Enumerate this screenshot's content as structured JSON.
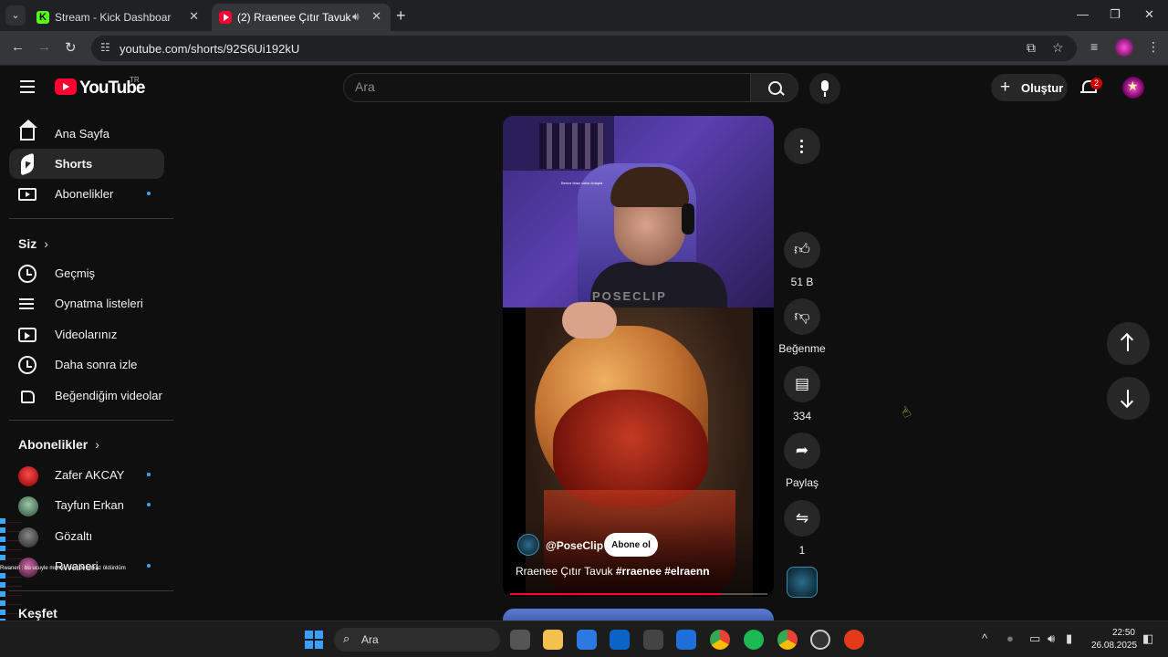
{
  "browser": {
    "tabs": [
      {
        "title": "Stream - Kick Dashboard",
        "active": false
      },
      {
        "title": "(2) Rraenee Çıtır Tavuk #rraenee",
        "active": true
      }
    ],
    "url": "youtube.com/shorts/92S6Ui192kU"
  },
  "header": {
    "logo_text": "YouTube",
    "region": "TR",
    "search_placeholder": "Ara",
    "create_label": "Oluştur",
    "notification_count": "2"
  },
  "sidebar": {
    "main": [
      {
        "label": "Ana Sayfa",
        "icon": "home-icon"
      },
      {
        "label": "Shorts",
        "icon": "shorts-icon",
        "active": true
      },
      {
        "label": "Abonelikler",
        "icon": "subscriptions-icon"
      }
    ],
    "you_heading": "Siz",
    "you": [
      {
        "label": "Geçmiş",
        "icon": "history-icon"
      },
      {
        "label": "Oynatma listeleri",
        "icon": "playlist-icon"
      },
      {
        "label": "Videolarınız",
        "icon": "your-videos-icon"
      },
      {
        "label": "Daha sonra izle",
        "icon": "watch-later-icon"
      },
      {
        "label": "Beğendiğim videolar",
        "icon": "liked-videos-icon"
      }
    ],
    "subs_heading": "Abonelikler",
    "subs": [
      {
        "label": "Zafer AKCAY"
      },
      {
        "label": "Tayfun Erkan"
      },
      {
        "label": "Gözaltı"
      },
      {
        "label": "Rwaneri"
      }
    ],
    "explore_heading": "Keşfet",
    "chat_banner": "Rwaneri : bu ucuyle memisi demde birkaz öldürdüm"
  },
  "short": {
    "cam_caption": "Bence biraz daha dolapta",
    "watermark": "POSECLIP",
    "channel": "@PoseClip",
    "subscribe_label": "Abone ol",
    "title_plain": "Rraenee Çıtır Tavuk ",
    "title_tags": "#rraenee #elraenn",
    "progress": 0.82
  },
  "actions": {
    "like_count": "51 B",
    "dislike_label": "Beğenme",
    "comment_count": "334",
    "share_label": "Paylaş",
    "remix_count": "1"
  },
  "taskbar": {
    "search_label": "Ara",
    "time": "22:50",
    "date": "26.08.2025"
  }
}
